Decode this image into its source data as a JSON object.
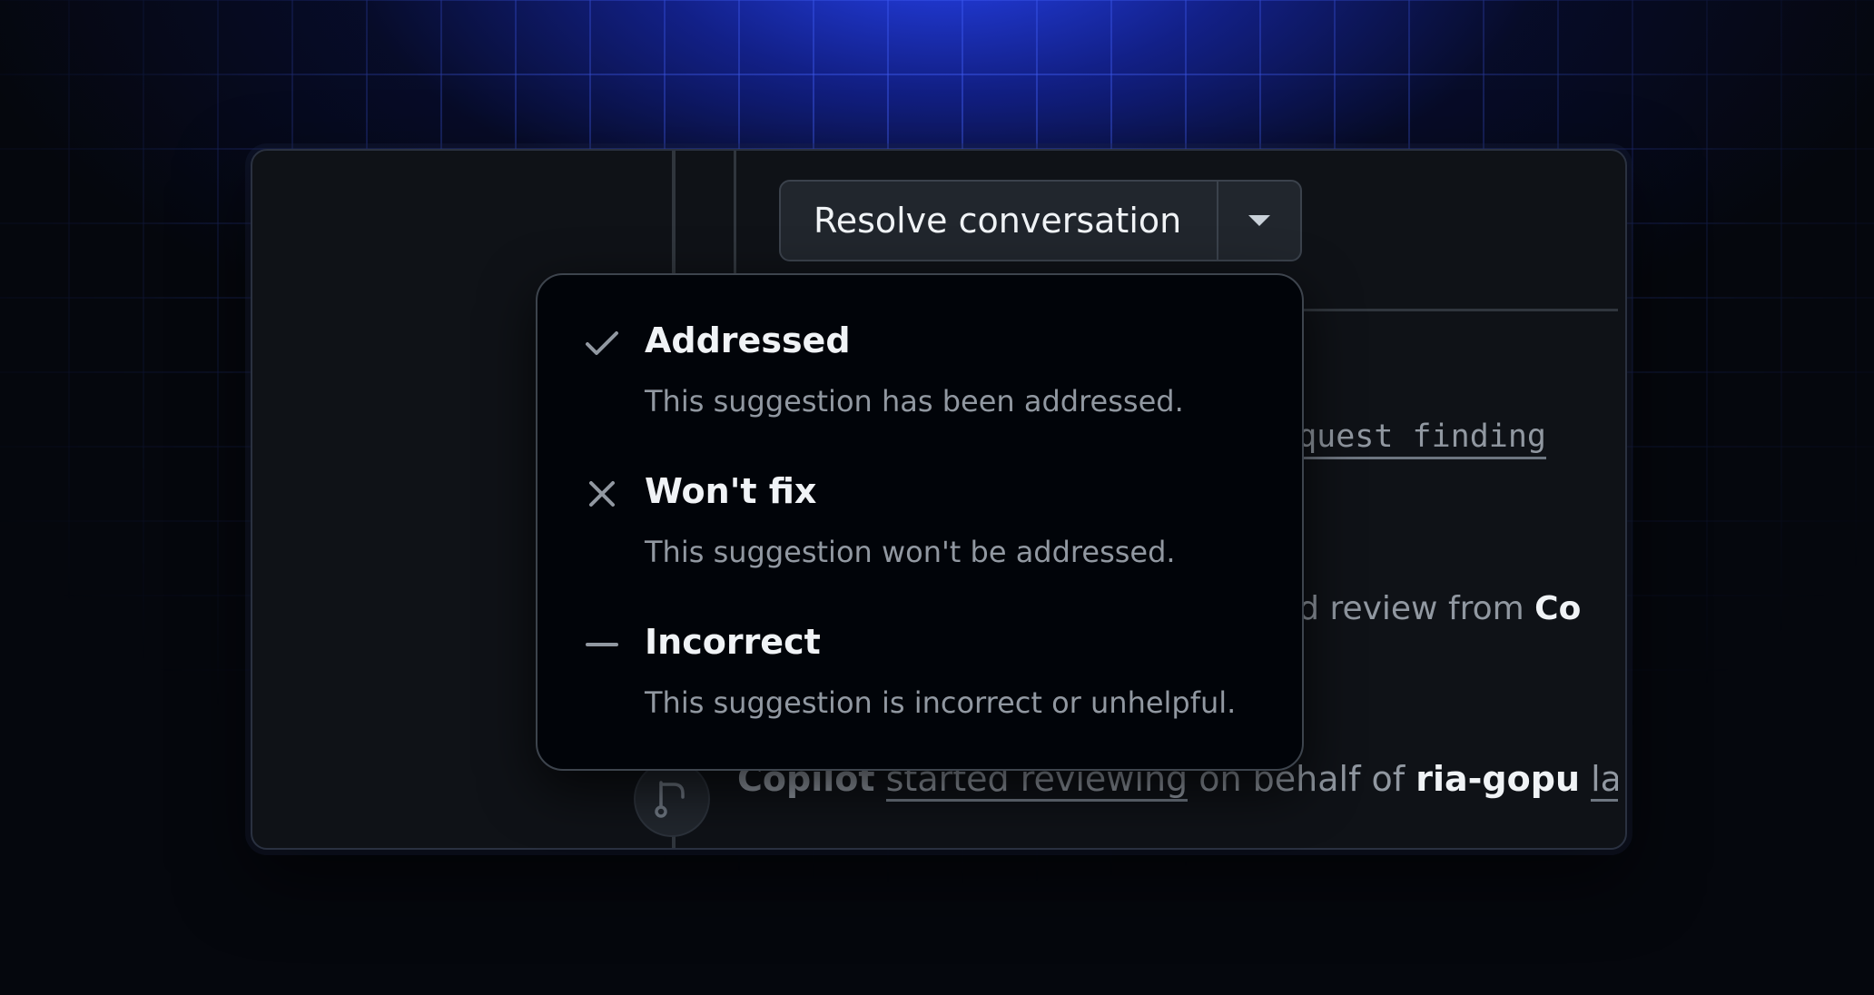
{
  "resolve_button": {
    "label": "Resolve conversation",
    "dropdown_icon": "triangle-down-icon"
  },
  "background_timeline": {
    "finding_fragment": "equest finding",
    "review_fragment_prefix": "ed review from ",
    "review_fragment_name": "Co",
    "event_actor": "Copilot",
    "event_action": "started reviewing",
    "event_middle": " on behalf of ",
    "event_user": "ria-gopu",
    "event_tail": "las",
    "event_icon": "git-pull-request-icon"
  },
  "resolve_menu": {
    "items": [
      {
        "icon": "check-icon",
        "title": "Addressed",
        "description": "This suggestion has been addressed."
      },
      {
        "icon": "x-icon",
        "title": "Won't fix",
        "description": "This suggestion won't be addressed."
      },
      {
        "icon": "dash-icon",
        "title": "Incorrect",
        "description": "This suggestion is incorrect or unhelpful."
      }
    ]
  },
  "colors": {
    "background": "#05070d",
    "glow": "#2846ff",
    "panel": "#0f1217",
    "menu": "#010409",
    "text_primary": "#f0f3f6",
    "text_muted": "#9198a1"
  }
}
